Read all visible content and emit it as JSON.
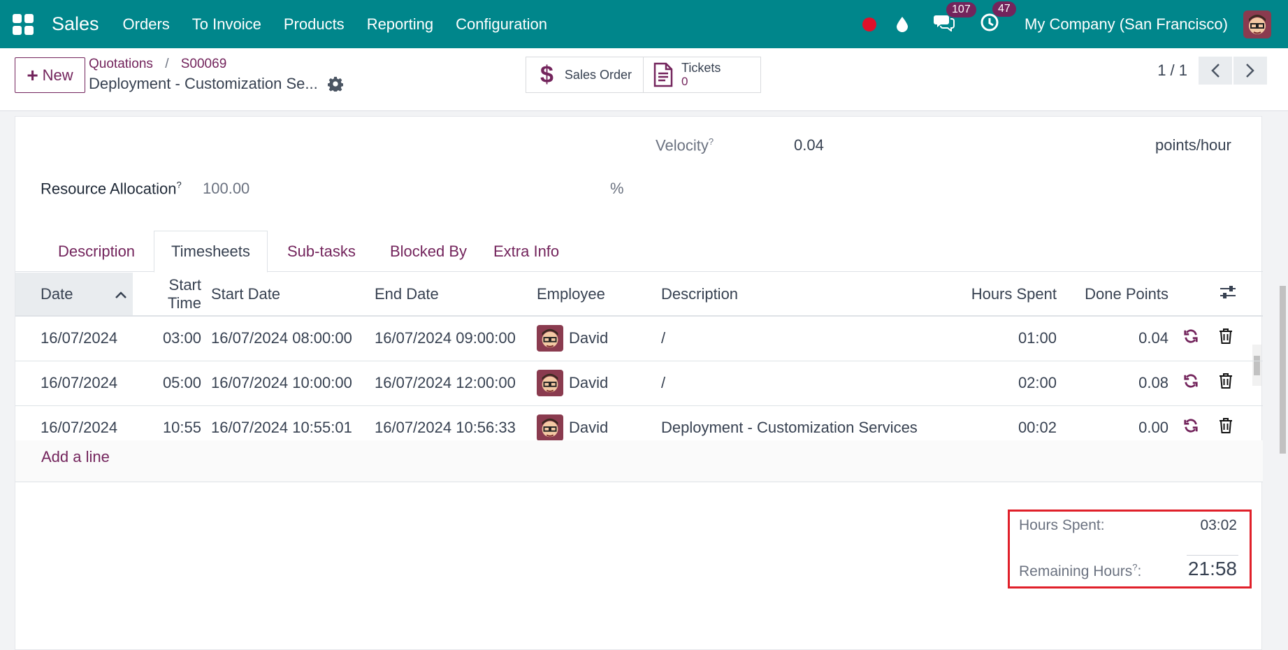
{
  "navbar": {
    "brand": "Sales",
    "menu": [
      "Orders",
      "To Invoice",
      "Products",
      "Reporting",
      "Configuration"
    ],
    "messages_badge": "107",
    "activities_badge": "47",
    "company": "My Company (San Francisco)"
  },
  "control_panel": {
    "new_label": "New",
    "breadcrumb": [
      "Quotations",
      "S00069"
    ],
    "breadcrumb_sep": "/",
    "record_title": "Deployment - Customization Se...",
    "smart_buttons": {
      "sales_order": "Sales Order",
      "tickets_label": "Tickets",
      "tickets_count": "0"
    },
    "pager": "1 / 1"
  },
  "form": {
    "velocity_label": "Velocity",
    "velocity_help": "?",
    "velocity_value": "0.04",
    "velocity_unit": "points/hour",
    "resource_label": "Resource Allocation",
    "resource_help": "?",
    "resource_value": "100.00",
    "resource_unit": "%"
  },
  "tabs": [
    "Description",
    "Timesheets",
    "Sub-tasks",
    "Blocked By",
    "Extra Info"
  ],
  "timesheet": {
    "columns": [
      "Date",
      "Start Time",
      "Start Date",
      "End Date",
      "Employee",
      "Description",
      "Hours Spent",
      "Done Points"
    ],
    "rows": [
      {
        "date": "16/07/2024",
        "start_time": "03:00",
        "start_date": "16/07/2024 08:00:00",
        "end_date": "16/07/2024 09:00:00",
        "employee": "David",
        "description": "/",
        "hours": "01:00",
        "points": "0.04"
      },
      {
        "date": "16/07/2024",
        "start_time": "05:00",
        "start_date": "16/07/2024 10:00:00",
        "end_date": "16/07/2024 12:00:00",
        "employee": "David",
        "description": "/",
        "hours": "02:00",
        "points": "0.08"
      },
      {
        "date": "16/07/2024",
        "start_time": "10:55",
        "start_date": "16/07/2024 10:55:01",
        "end_date": "16/07/2024 10:56:33",
        "employee": "David",
        "description": "Deployment - Customization Services",
        "hours": "00:02",
        "points": "0.00"
      }
    ],
    "add_line": "Add a line"
  },
  "totals": {
    "hours_spent_label": "Hours Spent:",
    "hours_spent_value": "03:02",
    "remaining_label": "Remaining Hours",
    "remaining_help": "?",
    "remaining_suffix": ":",
    "remaining_value": "21:58"
  },
  "colors": {
    "navbar": "#00868b",
    "accent": "#73245c",
    "highlight_border": "#e0202a"
  },
  "icons": [
    "apps-grid-icon",
    "record-dot-icon",
    "drop-icon",
    "chat-icon",
    "clock-icon",
    "gear-icon",
    "dollar-icon",
    "document-icon",
    "chevron-left-icon",
    "chevron-right-icon",
    "chevron-up-icon",
    "sliders-icon",
    "refresh-icon",
    "trash-icon"
  ]
}
